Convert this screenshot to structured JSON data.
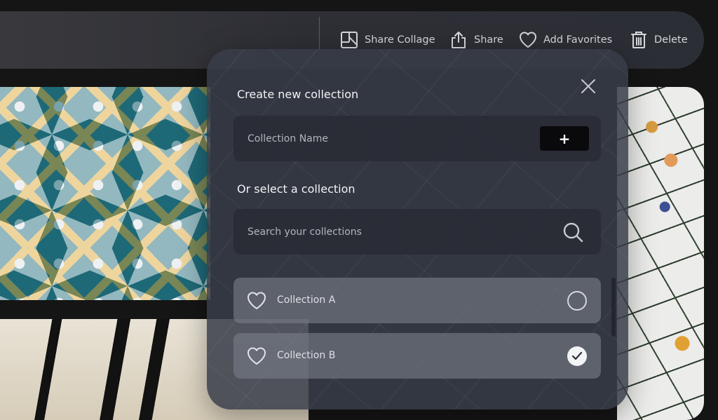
{
  "toolbar": {
    "share_collage": "Share Collage",
    "share": "Share",
    "add_favorites": "Add Favorites",
    "delete": "Delete"
  },
  "modal": {
    "create_title": "Create new collection",
    "name_placeholder": "Collection Name",
    "add_label": "+",
    "select_title": "Or select a collection",
    "search_placeholder": "Search your collections",
    "collections": [
      {
        "label": "Collection A",
        "selected": false
      },
      {
        "label": "Collection B",
        "selected": true
      }
    ]
  }
}
